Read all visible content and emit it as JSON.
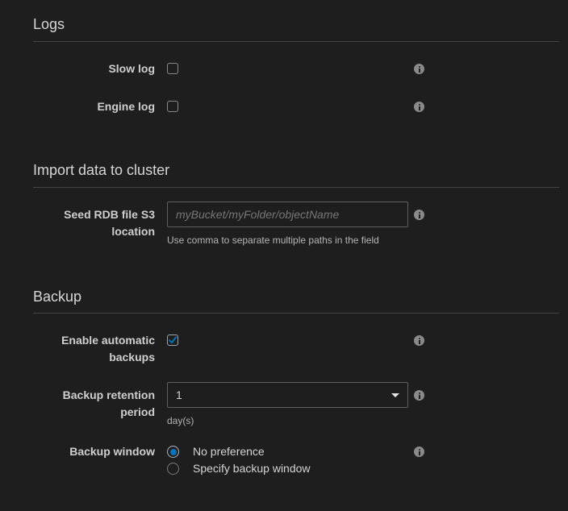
{
  "logs": {
    "title": "Logs",
    "slow_log": {
      "label": "Slow log",
      "checked": false
    },
    "engine_log": {
      "label": "Engine log",
      "checked": false
    }
  },
  "import": {
    "title": "Import data to cluster",
    "seed_label_line1": "Seed RDB file S3",
    "seed_label_line2": "location",
    "seed_placeholder": "myBucket/myFolder/objectName",
    "seed_value": "",
    "seed_hint": "Use comma to separate multiple paths in the field"
  },
  "backup": {
    "title": "Backup",
    "auto_label_line1": "Enable automatic",
    "auto_label_line2": "backups",
    "auto_checked": true,
    "retention_label_line1": "Backup retention",
    "retention_label_line2": "period",
    "retention_value": "1",
    "retention_unit": "day(s)",
    "window_label": "Backup window",
    "window_options": [
      {
        "label": "No preference",
        "selected": true
      },
      {
        "label": "Specify backup window",
        "selected": false
      }
    ]
  },
  "icons": {
    "info": "info-icon",
    "checkmark": "checkmark-icon",
    "caret": "caret-down-icon"
  },
  "colors": {
    "background": "#1e1e1e",
    "accent": "#0073bb"
  }
}
